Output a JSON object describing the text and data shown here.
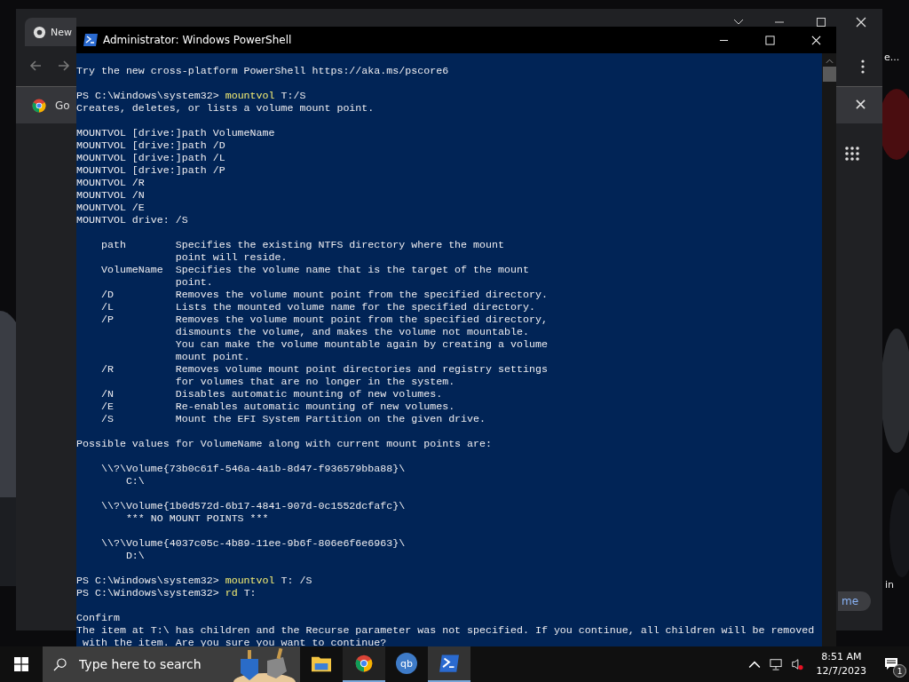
{
  "desktop": {
    "labels": [
      {
        "text": "e..."
      },
      {
        "text": "in"
      }
    ]
  },
  "browser": {
    "tab": {
      "title": "New"
    },
    "bookmark": {
      "label": "Go"
    },
    "side_button": {
      "label": "me"
    }
  },
  "console": {
    "title": "Administrator: Windows PowerShell",
    "lines": [
      {
        "kind": "output",
        "text": "Try the new cross-platform PowerShell https://aka.ms/pscore6"
      },
      {
        "kind": "blank"
      },
      {
        "kind": "prompt",
        "prompt": "PS C:\\Windows\\system32> ",
        "command": "mountvol",
        "args": " T:/S"
      },
      {
        "kind": "output",
        "text": "Creates, deletes, or lists a volume mount point."
      },
      {
        "kind": "blank"
      },
      {
        "kind": "output",
        "text": "MOUNTVOL [drive:]path VolumeName"
      },
      {
        "kind": "output",
        "text": "MOUNTVOL [drive:]path /D"
      },
      {
        "kind": "output",
        "text": "MOUNTVOL [drive:]path /L"
      },
      {
        "kind": "output",
        "text": "MOUNTVOL [drive:]path /P"
      },
      {
        "kind": "output",
        "text": "MOUNTVOL /R"
      },
      {
        "kind": "output",
        "text": "MOUNTVOL /N"
      },
      {
        "kind": "output",
        "text": "MOUNTVOL /E"
      },
      {
        "kind": "output",
        "text": "MOUNTVOL drive: /S"
      },
      {
        "kind": "blank"
      },
      {
        "kind": "output",
        "text": "    path        Specifies the existing NTFS directory where the mount"
      },
      {
        "kind": "output",
        "text": "                point will reside."
      },
      {
        "kind": "output",
        "text": "    VolumeName  Specifies the volume name that is the target of the mount"
      },
      {
        "kind": "output",
        "text": "                point."
      },
      {
        "kind": "output",
        "text": "    /D          Removes the volume mount point from the specified directory."
      },
      {
        "kind": "output",
        "text": "    /L          Lists the mounted volume name for the specified directory."
      },
      {
        "kind": "output",
        "text": "    /P          Removes the volume mount point from the specified directory,"
      },
      {
        "kind": "output",
        "text": "                dismounts the volume, and makes the volume not mountable."
      },
      {
        "kind": "output",
        "text": "                You can make the volume mountable again by creating a volume"
      },
      {
        "kind": "output",
        "text": "                mount point."
      },
      {
        "kind": "output",
        "text": "    /R          Removes volume mount point directories and registry settings"
      },
      {
        "kind": "output",
        "text": "                for volumes that are no longer in the system."
      },
      {
        "kind": "output",
        "text": "    /N          Disables automatic mounting of new volumes."
      },
      {
        "kind": "output",
        "text": "    /E          Re-enables automatic mounting of new volumes."
      },
      {
        "kind": "output",
        "text": "    /S          Mount the EFI System Partition on the given drive."
      },
      {
        "kind": "blank"
      },
      {
        "kind": "output",
        "text": "Possible values for VolumeName along with current mount points are:"
      },
      {
        "kind": "blank"
      },
      {
        "kind": "output",
        "text": "    \\\\?\\Volume{73b0c61f-546a-4a1b-8d47-f936579bba88}\\"
      },
      {
        "kind": "output",
        "text": "        C:\\"
      },
      {
        "kind": "blank"
      },
      {
        "kind": "output",
        "text": "    \\\\?\\Volume{1b0d572d-6b17-4841-907d-0c1552dcfafc}\\"
      },
      {
        "kind": "output",
        "text": "        *** NO MOUNT POINTS ***"
      },
      {
        "kind": "blank"
      },
      {
        "kind": "output",
        "text": "    \\\\?\\Volume{4037c05c-4b89-11ee-9b6f-806e6f6e6963}\\"
      },
      {
        "kind": "output",
        "text": "        D:\\"
      },
      {
        "kind": "blank"
      },
      {
        "kind": "prompt",
        "prompt": "PS C:\\Windows\\system32> ",
        "command": "mountvol",
        "args": " T: /S"
      },
      {
        "kind": "prompt",
        "prompt": "PS C:\\Windows\\system32> ",
        "command": "rd",
        "args": " T:"
      },
      {
        "kind": "blank"
      },
      {
        "kind": "output",
        "text": "Confirm"
      },
      {
        "kind": "output",
        "text": "The item at T:\\ has children and the Recurse parameter was not specified. If you continue, all children will be removed"
      },
      {
        "kind": "output",
        "text": " with the item. Are you sure you want to continue?"
      }
    ]
  },
  "taskbar": {
    "search": {
      "placeholder": "Type here to search"
    },
    "apps": [
      {
        "kind": "folder",
        "active": false,
        "selected": false
      },
      {
        "kind": "chrome",
        "active": true,
        "selected": false
      },
      {
        "kind": "qb",
        "label": "qb",
        "active": false,
        "selected": false
      },
      {
        "kind": "powershell",
        "active": true,
        "selected": true
      }
    ],
    "clock": {
      "time": "8:51 AM",
      "date": "12/7/2023"
    },
    "notifications": {
      "count": "1"
    }
  }
}
